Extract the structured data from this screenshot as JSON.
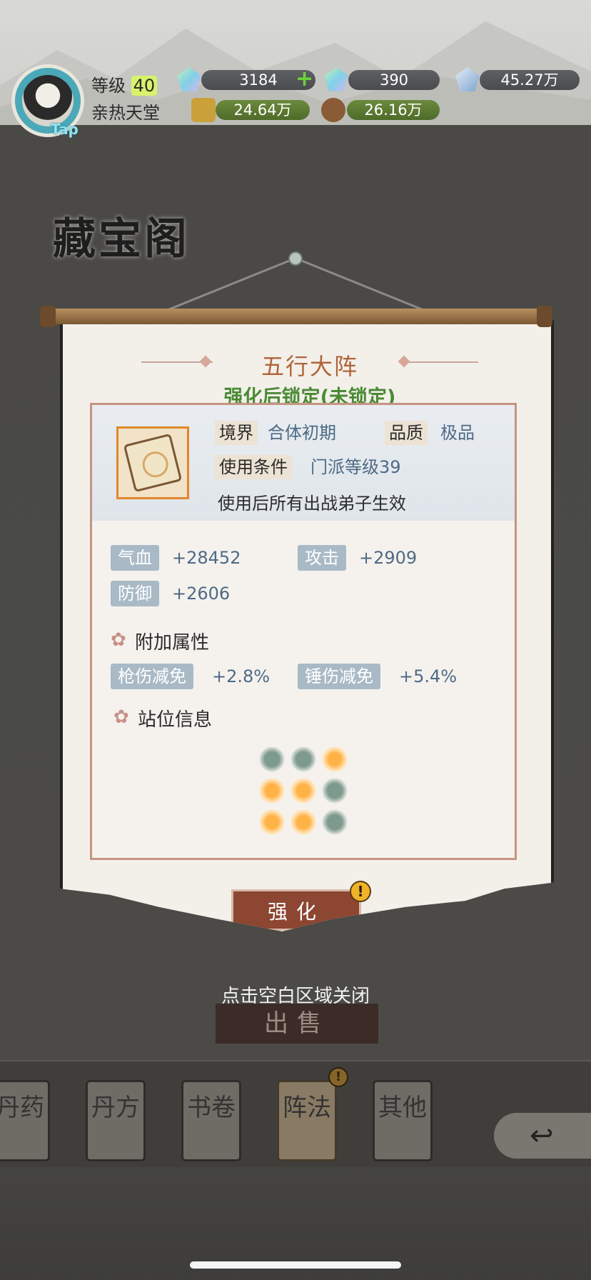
{
  "header": {
    "avatar_tag": "Tap",
    "level_label": "等级",
    "level": "40",
    "player_name": "亲热天堂",
    "resources": [
      {
        "icon": "jade-gem-icon",
        "value": "3184"
      },
      {
        "icon": "jade-gem-locked-icon",
        "value": "390"
      },
      {
        "icon": "crystal-icon",
        "value": "45.27万"
      },
      {
        "icon": "gold-ingot-icon",
        "value": "24.64万"
      },
      {
        "icon": "wood-log-icon",
        "value": "26.16万"
      }
    ],
    "plus": "+"
  },
  "page_title": "藏宝阁",
  "dialog": {
    "title": "五行大阵",
    "lock_status": "强化后锁定(未锁定)",
    "realm_label": "境界",
    "realm_value": "合体初期",
    "quality_label": "品质",
    "quality_value": "极品",
    "condition_label": "使用条件",
    "condition_value": "门派等级39",
    "effect": "使用后所有出战弟子生效",
    "stats": [
      {
        "label": "气血",
        "value": "+28452"
      },
      {
        "label": "攻击",
        "value": "+2909"
      },
      {
        "label": "防御",
        "value": "+2606"
      }
    ],
    "extra_heading": "附加属性",
    "extra_stats": [
      {
        "label": "枪伤减免",
        "value": "+2.8%"
      },
      {
        "label": "锤伤减免",
        "value": "+5.4%"
      }
    ],
    "position_heading": "站位信息",
    "position_grid": [
      [
        false,
        false,
        true
      ],
      [
        true,
        true,
        false
      ],
      [
        true,
        true,
        false
      ]
    ],
    "enhance_label": "强化",
    "alert_glyph": "!"
  },
  "close_hint": "点击空白区域关闭",
  "sell_label": "出售",
  "tabs": [
    {
      "label": "丹药"
    },
    {
      "label": "丹方"
    },
    {
      "label": "书卷"
    },
    {
      "label": "阵法"
    },
    {
      "label": "其他"
    }
  ],
  "tab_alert": "!",
  "back_glyph": "↩"
}
